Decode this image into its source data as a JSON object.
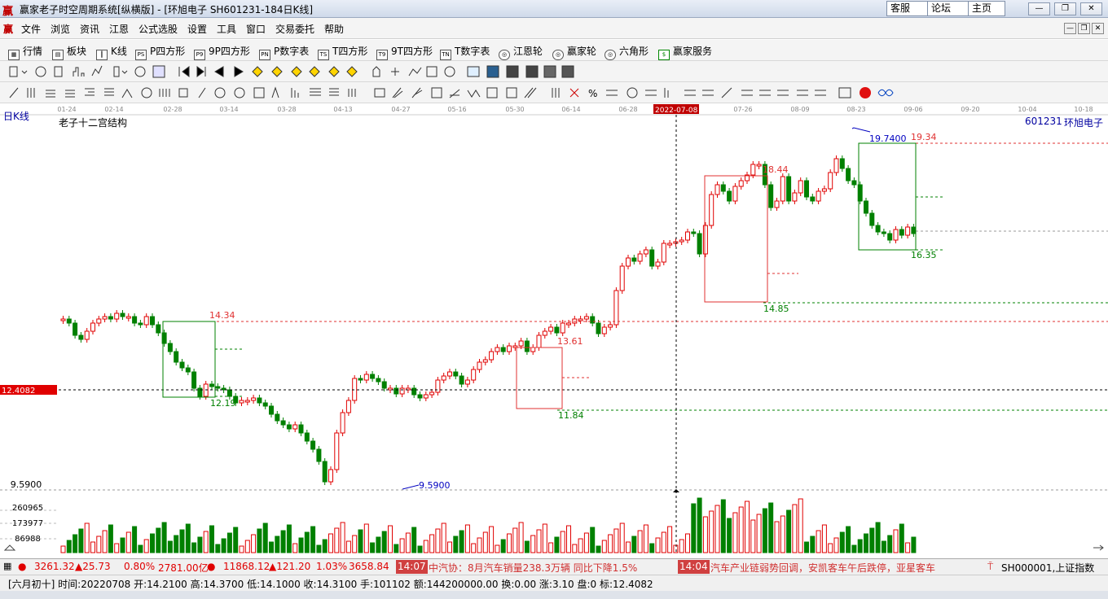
{
  "window": {
    "logo": "赢",
    "title": "赢家老子时空周期系统[纵横版] - [环旭电子  SH601231-184日K线]",
    "links": [
      "客服",
      "论坛",
      "主页"
    ],
    "controls": [
      "—",
      "❐",
      "✕"
    ]
  },
  "menu": {
    "logo": "赢",
    "items": [
      "文件",
      "浏览",
      "资讯",
      "江恩",
      "公式选股",
      "设置",
      "工具",
      "窗口",
      "交易委托",
      "帮助"
    ]
  },
  "toolbar1": {
    "items": [
      {
        "label": "行情",
        "icon": "▦"
      },
      {
        "label": "板块",
        "icon": "▤"
      },
      {
        "label": "K线",
        "icon": "┃"
      },
      {
        "label": "P四方形",
        "icon": "PS"
      },
      {
        "label": "9P四方形",
        "icon": "P9"
      },
      {
        "label": "P数字表",
        "icon": "PN"
      },
      {
        "label": "T四方形",
        "icon": "TS"
      },
      {
        "label": "9T四方形",
        "icon": "T9"
      },
      {
        "label": "T数字表",
        "icon": "TN"
      },
      {
        "label": "江恩轮",
        "icon": "◎"
      },
      {
        "label": "赢家轮",
        "icon": "◎"
      },
      {
        "label": "六角形",
        "icon": "◎"
      },
      {
        "label": "赢家服务",
        "icon": "$"
      }
    ]
  },
  "chart": {
    "period_label": "日K线",
    "indicator_name": "老子十二宫结构",
    "stock_code": "601231",
    "stock_name": "环旭电子",
    "dates": [
      "01-24",
      "02-14",
      "02-28",
      "03-14",
      "03-28",
      "04-13",
      "04-27",
      "05-16",
      "05-30",
      "06-14",
      "06-28",
      "07-26",
      "08-09",
      "08-23",
      "09-06",
      "09-20",
      "10-04",
      "10-18"
    ],
    "cursor_date": "2022-07-08",
    "cursor_price": "12.4082",
    "axis_price": "9.5900",
    "volume_axis": [
      "260965",
      "173977",
      "86988"
    ],
    "labels": {
      "p1434": "14.34",
      "p1219": "12.19",
      "p959": "9.5900",
      "p1361": "13.61",
      "p1184": "11.84",
      "p1844": "18.44",
      "p1485": "14.85",
      "p1974": "19.7400",
      "p1934": "19.34",
      "p1635": "16.35"
    },
    "colors": {
      "up": "#e00000",
      "down": "#008000",
      "grid": "#9a9a9a",
      "cursor": "#000000"
    }
  },
  "status1": {
    "index1_value": "3261.32",
    "index1_change": "▲25.73",
    "index1_pct": "0.80%",
    "index1_amount": "2781.00亿",
    "index2_value": "11868.12",
    "index2_change": "▲121.20",
    "index2_pct": "1.03%",
    "index2_amount": "3658.84",
    "news1_time": "14:07",
    "news1_text": "中汽协：8月汽车销量238.3万辆 同比下降1.5%",
    "news2_time": "14:04",
    "news2_text": "汽车产业链弱势回调，安凯客车午后跌停，亚星客车",
    "index_code": "SH000001,上证指数"
  },
  "status2": {
    "text": "[六月初十] 时间:20220708 开:14.2100 高:14.3700 低:14.1000 收:14.3100 手:101102 额:144200000.00 换:0.00 涨:3.10 盘:0 标:12.4082"
  }
}
